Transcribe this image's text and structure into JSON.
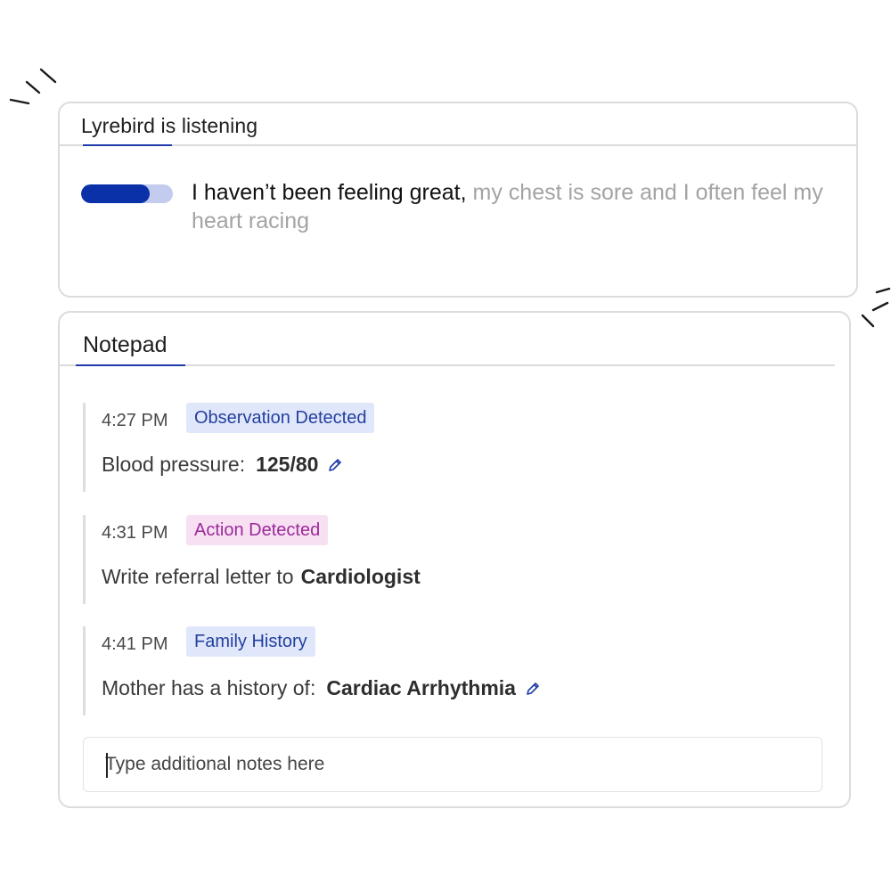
{
  "listening": {
    "title": "Lyrebird is listening",
    "audio_level": 0.75,
    "transcript_heard": "I haven’t been feeling great,",
    "transcript_pending": "my chest is sore and I often feel my heart racing"
  },
  "notepad": {
    "title": "Notepad",
    "entries": [
      {
        "time": "4:27 PM",
        "badge": "Observation Detected",
        "text": "Blood pressure:",
        "value": "125/80"
      },
      {
        "time": "4:31 PM",
        "badge": "Action Detected",
        "text": "Write referral letter to",
        "value": "Cardiologist"
      },
      {
        "time": "4:41 PM",
        "badge": "Family History",
        "text": "Mother has a history of:",
        "value": "Cardiac Arrhythmia"
      }
    ],
    "input_placeholder": "Type additional notes here"
  },
  "colors": {
    "accent": "#1f3aa8",
    "observation_badge_bg": "#e1e7fb",
    "action_badge_bg": "#f7e0f2"
  },
  "icons": {
    "edit": "pencil-icon"
  }
}
